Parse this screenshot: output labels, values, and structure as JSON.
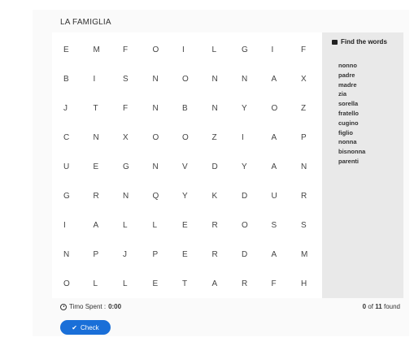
{
  "puzzle": {
    "title": "LA FAMIGLIA",
    "grid": [
      [
        "E",
        "M",
        "F",
        "O",
        "I",
        "L",
        "G",
        "I",
        "F"
      ],
      [
        "B",
        "I",
        "S",
        "N",
        "O",
        "N",
        "N",
        "A",
        "X"
      ],
      [
        "J",
        "T",
        "F",
        "N",
        "B",
        "N",
        "Y",
        "O",
        "Z"
      ],
      [
        "C",
        "N",
        "X",
        "O",
        "O",
        "Z",
        "I",
        "A",
        "P"
      ],
      [
        "U",
        "E",
        "G",
        "N",
        "V",
        "D",
        "Y",
        "A",
        "N"
      ],
      [
        "G",
        "R",
        "N",
        "Q",
        "Y",
        "K",
        "D",
        "U",
        "R"
      ],
      [
        "I",
        "A",
        "L",
        "L",
        "E",
        "R",
        "O",
        "S",
        "S"
      ],
      [
        "N",
        "P",
        "J",
        "P",
        "E",
        "R",
        "D",
        "A",
        "M"
      ],
      [
        "O",
        "L",
        "L",
        "E",
        "T",
        "A",
        "R",
        "F",
        "H"
      ]
    ]
  },
  "sidebar": {
    "heading": "Find the words",
    "heading_icon": "book-icon",
    "words": [
      "nonno",
      "padre",
      "madre",
      "zia",
      "sorella",
      "fratello",
      "cugino",
      "figlio",
      "nonna",
      "bisnonna",
      "parenti"
    ]
  },
  "footer": {
    "time_label": "Timo Spent :",
    "time_value": "0:00",
    "found_count": "0",
    "found_mid": "of",
    "total": "11",
    "found_suffix": "found",
    "check_label": "Check",
    "check_icon": "check-icon"
  },
  "colors": {
    "accent": "#1a6fd8",
    "sidebar_bg": "#e9e9e9"
  }
}
